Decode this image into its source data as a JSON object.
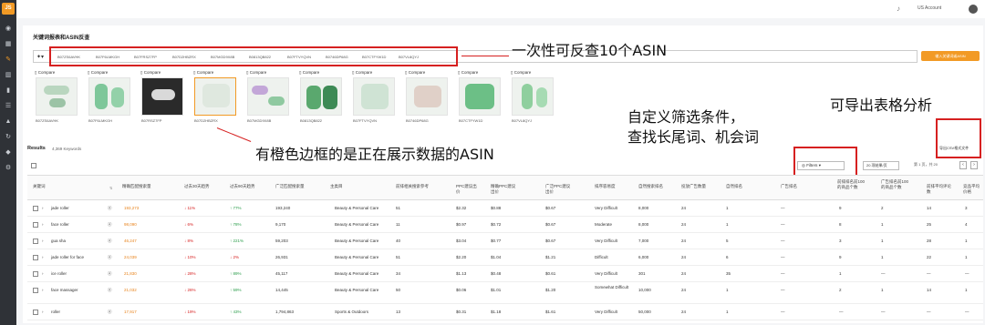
{
  "sidebar": {
    "logo": "JS"
  },
  "topbar": {
    "account": "US Account"
  },
  "page": {
    "title": "关键词报表和ASIN反查",
    "asin_chips": [
      "B07ZS6AVHK",
      "B07F6LMKGH",
      "B07FRSZ7FP",
      "B07D2HBZRX",
      "B07MGD9X8B",
      "B0813QB822",
      "B07FTVYQVN",
      "B0746DP68G",
      "B07CTFYW1D",
      "B07VL8QYJ"
    ],
    "reverse_button": "输入关键词或ASIN",
    "compare_label": "Compare",
    "results_label": "Results",
    "results_count": "4,369 Keywords",
    "filters_label": "Filters",
    "per_page": "20 项结果/页",
    "pager_text": "第 1 页，共 20",
    "export_label": "导出CSV格式文件"
  },
  "annotations": {
    "a1": "一次性可反查10个ASIN",
    "a2": "有橙色边框的是正在展示数据的ASIN",
    "a3_line1": "自定义筛选条件，",
    "a3_line2": "查找长尾词、机会词",
    "a4": "可导出表格分析"
  },
  "products": [
    {
      "asin": "B07ZS6AVHK"
    },
    {
      "asin": "B07F6LMKGH"
    },
    {
      "asin": "B07RSZ7FP"
    },
    {
      "asin": "B07D2HBZRX"
    },
    {
      "asin": "B07MGD9X8B"
    },
    {
      "asin": "B0813QB822"
    },
    {
      "asin": "B07FTVYQVN"
    },
    {
      "asin": "B0746DP68G"
    },
    {
      "asin": "B07CTFYW1D"
    },
    {
      "asin": "B07VL8QYJ"
    }
  ],
  "table": {
    "headers": [
      "关键词",
      "精确匹配搜索量",
      "过去30天趋势",
      "过去90天趋势",
      "广泛匹配搜索量",
      "主类目",
      "前排相关搜索参考",
      "PPC建议出价",
      "精确PPC建议出价",
      "广泛PPC建议出价",
      "排序容易度",
      "自然搜索排名",
      "投放广告数量",
      "自然排名",
      "广告排名",
      "前排排名前100的商品个数",
      "广告排名前100的商品个数",
      "前排平均评论数",
      "竞品平均价格"
    ],
    "rows": [
      {
        "kw": "jade roller",
        "vol": "193,273",
        "t30": "↓ 11%",
        "t90": "↑ 77%",
        "broad": "193,240",
        "cat": "Beauty & Personal Care",
        "rel": "51",
        "ppc": "$2.32",
        "exact": "$0.88",
        "wide": "$0.67",
        "ease": "Very Difficult",
        "nat": "8,000",
        "ads": "24",
        "rank": "1",
        "adr": "—",
        "top": "9",
        "adtop": "2",
        "rev": "14",
        "price": "3"
      },
      {
        "kw": "face roller",
        "vol": "98,090",
        "t30": "↓ 6%",
        "t90": "↑ 78%",
        "broad": "9,170",
        "cat": "Beauty & Personal Care",
        "rel": "11",
        "ppc": "$0.97",
        "exact": "$0.72",
        "wide": "$0.67",
        "ease": "Moderate",
        "nat": "8,000",
        "ads": "24",
        "rank": "1",
        "adr": "—",
        "top": "8",
        "adtop": "1",
        "rev": "25",
        "price": "4"
      },
      {
        "kw": "gua sha",
        "vol": "46,247",
        "t30": "↓ 8%",
        "t90": "↑ 221%",
        "broad": "59,203",
        "cat": "Beauty & Personal Care",
        "rel": "40",
        "ppc": "$3.04",
        "exact": "$0.77",
        "wide": "$0.67",
        "ease": "Very Difficult",
        "nat": "7,000",
        "ads": "24",
        "rank": "5",
        "adr": "—",
        "top": "3",
        "adtop": "1",
        "rev": "28",
        "price": "1"
      },
      {
        "kw": "jade roller for face",
        "vol": "24,039",
        "t30": "↓ 10%",
        "t90": "↓ 2%",
        "broad": "26,931",
        "cat": "Beauty & Personal Care",
        "rel": "51",
        "ppc": "$2.20",
        "exact": "$1.04",
        "wide": "$1.21",
        "ease": "Difficult",
        "nat": "6,000",
        "ads": "24",
        "rank": "6",
        "adr": "—",
        "top": "9",
        "adtop": "1",
        "rev": "22",
        "price": "1"
      },
      {
        "kw": "ice roller",
        "vol": "21,830",
        "t30": "↓ 28%",
        "t90": "↑ 89%",
        "broad": "45,117",
        "cat": "Beauty & Personal Care",
        "rel": "34",
        "ppc": "$1.13",
        "exact": "$0.48",
        "wide": "$0.61",
        "ease": "Very Difficult",
        "nat": "301",
        "ads": "24",
        "rank": "35",
        "adr": "—",
        "top": "1",
        "adtop": "—",
        "rev": "—",
        "price": "—"
      },
      {
        "kw": "face massager",
        "vol": "21,032",
        "t30": "↓ 26%",
        "t90": "↑ 59%",
        "broad": "14,445",
        "cat": "Beauty & Personal Care",
        "rel": "50",
        "ppc": "$0.06",
        "exact": "$1.01",
        "wide": "$1.20",
        "ease": "Somewhat Difficult",
        "nat": "10,000",
        "ads": "24",
        "rank": "1",
        "adr": "—",
        "top": "2",
        "adtop": "1",
        "rev": "14",
        "price": "1"
      },
      {
        "kw": "roller",
        "vol": "17,917",
        "t30": "↓ 19%",
        "t90": "↑ 43%",
        "broad": "1,794,863",
        "cat": "Sports & Outdoors",
        "rel": "13",
        "ppc": "$0.31",
        "exact": "$1.18",
        "wide": "$1.61",
        "ease": "Very Difficult",
        "nat": "50,000",
        "ads": "24",
        "rank": "1",
        "adr": "—",
        "top": "—",
        "adtop": "—",
        "rev": "—",
        "price": "—"
      }
    ]
  },
  "colors": {
    "accent": "#f29a25",
    "annotation_red": "#d62020",
    "sidebar": "#2f3237"
  }
}
